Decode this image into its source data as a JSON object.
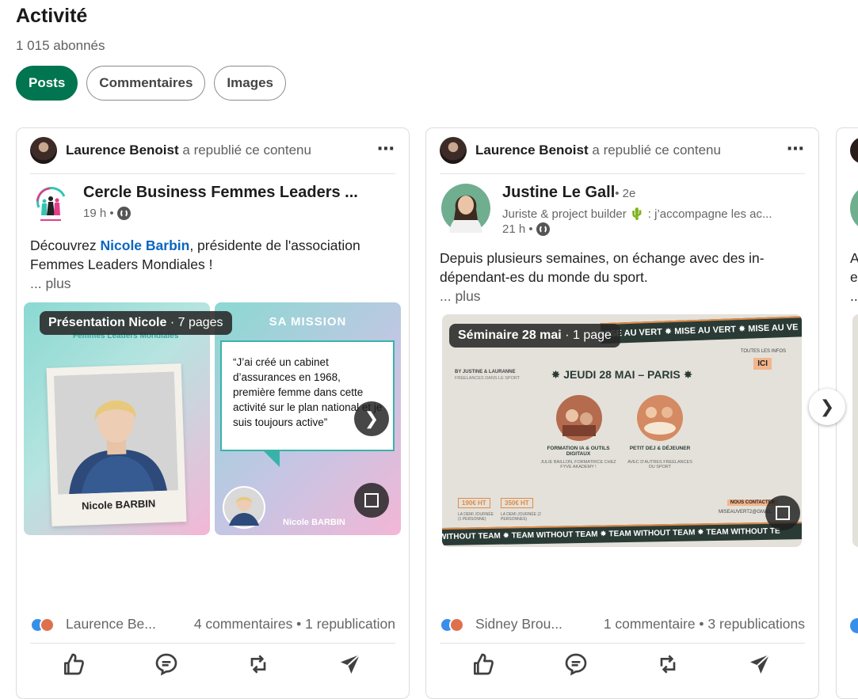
{
  "header": {
    "title": "Activité",
    "followers": "1 015 abonnés"
  },
  "tabs": [
    {
      "label": "Posts",
      "active": true
    },
    {
      "label": "Commentaires",
      "active": false
    },
    {
      "label": "Images",
      "active": false
    }
  ],
  "posts": [
    {
      "reposter_name": "Laurence Benoist",
      "reposter_action": "a republié ce contenu",
      "author_name": "Cercle Business Femmes Leaders ...",
      "author_time": "19 h •",
      "text_before": "Découvrez ",
      "text_link": "Nicole Barbin",
      "text_after": ", présidente de l'association Femmes Leaders Mondiales !",
      "more": "... plus",
      "doc_title": "Présentation Nicole",
      "doc_pages": " · 7 pages",
      "slide1_header": "Femmes Leaders Mondiales",
      "slide1_caption": "Nicole BARBIN",
      "slide2_title": "SA MISSION",
      "slide2_quote": "“J’ai créé un cabinet d’assurances en 1968, première femme dans cette activité sur le plan national et je suis toujours active”",
      "slide2_signature": "Nicole BARBIN",
      "reaction_names": "Laurence Be...",
      "stats": "4 commentaires • 1 republication"
    },
    {
      "reposter_name": "Laurence Benoist",
      "reposter_action": "a republié ce contenu",
      "author_name": "Justine Le Gall",
      "author_degree": "• 2e",
      "author_headline": "Juriste & project builder 🌵 : j’accompagne les ac...",
      "author_time": "21 h •",
      "text": "Depuis plusieurs semaines, on échange avec des in-dépendant-es du monde du sport.",
      "more": "... plus",
      "doc_title": "Séminaire 28 mai",
      "doc_pages": " · 1 page",
      "slide_top_banner": "MISE AU VERT ✸ MISE AU VERT ✸ MISE AU VE",
      "slide_brand": "BY JUSTINE & LAURANNE",
      "slide_brand_sub": "FREELANCES DANS LE SPORT",
      "slide_info": "TOUTES LES INFOS",
      "slide_cta": "ICI",
      "slide_headline": "✸ JEUDI 28 MAI – PARIS ✸",
      "slide_item1_title": "FORMATION IA & OUTILS DIGITAUX",
      "slide_item1_sub": "JULIE BAILLON, FORMATRICE CHEZ FYVE AKADEMY !",
      "slide_item2_title": "PETIT DEJ & DÉJEUNER",
      "slide_item2_sub": "AVEC D’AUTRES FREELANCES DU SPORT",
      "slide_price1": "190€ HT",
      "slide_price1_sub": "LA DEMI JOURNÉE (1 PERSONNE)",
      "slide_price2": "350€ HT",
      "slide_price2_sub": "LA DEMI JOURNÉE (2 PERSONNES)",
      "slide_contact": "NOUS CONTACTER",
      "slide_email": "MISEAUVERT2@GMAIL",
      "slide_bottom_banner": "WITHOUT TEAM ✸ TEAM WITHOUT TEAM ✸ TEAM WITHOUT TEAM ✸ TEAM WITHOUT TE",
      "reaction_names": "Sidney Brou...",
      "stats": "1 commentaire • 3 republications"
    }
  ],
  "peek_text": {
    "l1": "A",
    "l2": "e",
    "l3": ".."
  },
  "icons": {
    "more": "⋯",
    "next": "❯"
  },
  "colors": {
    "accent": "#01754f",
    "link": "#0a66c2"
  }
}
